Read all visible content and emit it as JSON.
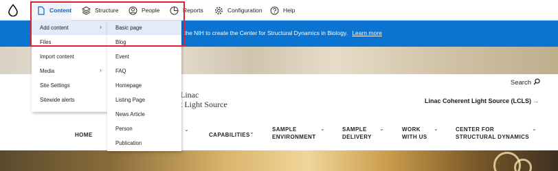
{
  "toolbar": {
    "logo_icon": "drop-icon",
    "items": [
      {
        "label": "Content",
        "icon": "document-icon"
      },
      {
        "label": "Structure",
        "icon": "layers-icon"
      },
      {
        "label": "People",
        "icon": "person-icon"
      },
      {
        "label": "Reports",
        "icon": "chart-pie-icon"
      },
      {
        "label": "Configuration",
        "icon": "gear-icon"
      },
      {
        "label": "Help",
        "icon": "help-icon"
      }
    ],
    "active_color": "#0b62c4"
  },
  "banner": {
    "text": "the NIH to create the Center for Structural Dynamics in Biology.",
    "link": "Learn more",
    "color": "#0b74d1"
  },
  "content_menu": {
    "items": [
      {
        "label": "Add content"
      },
      {
        "label": "Files"
      },
      {
        "label": "Import content"
      },
      {
        "label": "Media"
      },
      {
        "label": "Site Settings"
      },
      {
        "label": "Sitewide alerts"
      }
    ]
  },
  "add_content_menu": {
    "items": [
      {
        "label": "Basic page"
      },
      {
        "label": "Blog"
      },
      {
        "label": "Event"
      },
      {
        "label": "FAQ"
      },
      {
        "label": "Homepage"
      },
      {
        "label": "Listing Page"
      },
      {
        "label": "News Article"
      },
      {
        "label": "Person"
      },
      {
        "label": "Publication"
      }
    ]
  },
  "header": {
    "search_label": "Search",
    "brand_line1": "Linac",
    "brand_line2": "t Light Source",
    "lcls_link": "Linac Coherent Light Source (LCLS)",
    "lcls_arrow": "→",
    "accent": "#c1272d"
  },
  "nav": {
    "home": "HOME",
    "capabilities": "CAPABILITIES",
    "sample_env": [
      "SAMPLE",
      "ENVIRONMENT"
    ],
    "sample_del": [
      "SAMPLE",
      "DELIVERY"
    ],
    "work": [
      "WORK",
      "WITH US"
    ],
    "center": [
      "CENTER FOR",
      "STRUCTURAL DYNAMICS"
    ]
  }
}
